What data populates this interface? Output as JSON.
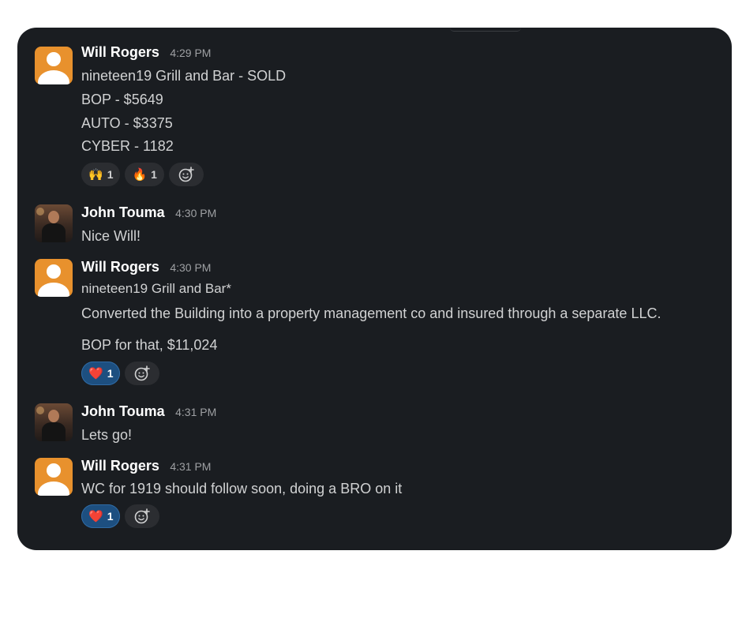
{
  "messages": [
    {
      "author": "Will Rogers",
      "time": "4:29 PM",
      "avatar": "default-avatar",
      "lines": [
        "nineteen19 Grill and Bar - SOLD",
        "BOP - $5649",
        "AUTO - $3375",
        "CYBER - 1182"
      ],
      "reactions": [
        {
          "emoji": "🙌",
          "icon": "raised-hands-icon",
          "count": "1",
          "active": false
        },
        {
          "emoji": "🔥",
          "icon": "fire-icon",
          "count": "1",
          "active": false
        }
      ]
    },
    {
      "author": "John Touma",
      "time": "4:30 PM",
      "avatar": "photo-avatar",
      "lines": [
        "Nice Will!"
      ]
    },
    {
      "author": "Will Rogers",
      "time": "4:30 PM",
      "avatar": "default-avatar",
      "lines": [
        "nineteen19 Grill and Bar*",
        "Converted the Building into a property management co and insured through a separate LLC.",
        "BOP for that,  $11,024"
      ],
      "reactions": [
        {
          "emoji": "❤️",
          "icon": "heart-icon",
          "count": "1",
          "active": true
        }
      ]
    },
    {
      "author": "John Touma",
      "time": "4:31 PM",
      "avatar": "photo-avatar",
      "lines": [
        "Lets go!"
      ]
    },
    {
      "author": "Will Rogers",
      "time": "4:31 PM",
      "avatar": "default-avatar",
      "lines": [
        "WC for 1919 should follow soon, doing a BRO on it"
      ],
      "reactions": [
        {
          "emoji": "❤️",
          "icon": "heart-icon",
          "count": "1",
          "active": true
        }
      ]
    }
  ],
  "colors": {
    "background": "#1a1d21",
    "active_reaction": "#1d4f80",
    "avatar_default": "#e8912d"
  }
}
